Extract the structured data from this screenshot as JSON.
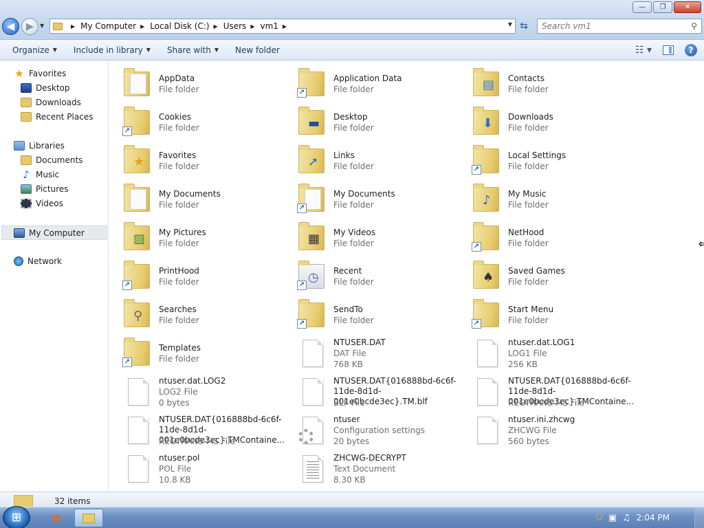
{
  "window": {
    "controls": {
      "minimize": "—",
      "maximize": "❐",
      "close": "✕"
    }
  },
  "nav": {
    "back": "◀",
    "forward": "▶"
  },
  "address": {
    "crumbs": [
      "My Computer",
      "Local Disk (C:)",
      "Users",
      "vm1"
    ]
  },
  "search": {
    "placeholder": "Search vm1"
  },
  "toolbar": {
    "organize": "Organize",
    "include": "Include in library",
    "share": "Share with",
    "new_folder": "New folder"
  },
  "sidebar": {
    "favorites": "Favorites",
    "desktop": "Desktop",
    "downloads": "Downloads",
    "recent": "Recent Places",
    "libraries": "Libraries",
    "documents": "Documents",
    "music": "Music",
    "pictures": "Pictures",
    "videos": "Videos",
    "computer": "My Computer",
    "network": "Network"
  },
  "items": [
    {
      "name": "AppData",
      "type": "File folder"
    },
    {
      "name": "Application Data",
      "type": "File folder"
    },
    {
      "name": "Contacts",
      "type": "File folder"
    },
    {
      "name": "Cookies",
      "type": "File folder"
    },
    {
      "name": "Desktop",
      "type": "File folder"
    },
    {
      "name": "Downloads",
      "type": "File folder"
    },
    {
      "name": "Favorites",
      "type": "File folder"
    },
    {
      "name": "Links",
      "type": "File folder"
    },
    {
      "name": "Local Settings",
      "type": "File folder"
    },
    {
      "name": "My Documents",
      "type": "File folder"
    },
    {
      "name": "My Documents",
      "type": "File folder"
    },
    {
      "name": "My Music",
      "type": "File folder"
    },
    {
      "name": "My Pictures",
      "type": "File folder"
    },
    {
      "name": "My Videos",
      "type": "File folder"
    },
    {
      "name": "NetHood",
      "type": "File folder"
    },
    {
      "name": "PrintHood",
      "type": "File folder"
    },
    {
      "name": "Recent",
      "type": "File folder"
    },
    {
      "name": "Saved Games",
      "type": "File folder"
    },
    {
      "name": "Searches",
      "type": "File folder"
    },
    {
      "name": "SendTo",
      "type": "File folder"
    },
    {
      "name": "Start Menu",
      "type": "File folder"
    },
    {
      "name": "Templates",
      "type": "File folder"
    },
    {
      "name": "NTUSER.DAT",
      "type": "DAT File",
      "size": "768 KB"
    },
    {
      "name": "ntuser.dat.LOG1",
      "type": "LOG1 File",
      "size": "256 KB"
    },
    {
      "name": "ntuser.dat.LOG2",
      "type": "LOG2 File",
      "size": "0 bytes"
    },
    {
      "name": "NTUSER.DAT{016888bd-6c6f-11de-8d1d-001e0bcde3ec}.TM.blf",
      "type": "BLF File"
    },
    {
      "name": "NTUSER.DAT{016888bd-6c6f-11de-8d1d-001e0bcde3ec}.TMContaine...",
      "type": "REGTRANS-MS File"
    },
    {
      "name": "NTUSER.DAT{016888bd-6c6f-11de-8d1d-001e0bcde3ec}.TMContaine...",
      "type": "REGTRANS-MS File"
    },
    {
      "name": "ntuser",
      "type": "Configuration settings",
      "size": "20 bytes"
    },
    {
      "name": "ntuser.ini.zhcwg",
      "type": "ZHCWG File",
      "size": "560 bytes"
    },
    {
      "name": "ntuser.pol",
      "type": "POL File",
      "size": "10.8 KB"
    },
    {
      "name": "ZHCWG-DECRYPT",
      "type": "Text Document",
      "size": "8.30 KB"
    }
  ],
  "status": {
    "count": "32 items"
  },
  "taskbar": {
    "time": "2:04 PM"
  },
  "colors": {
    "accent": "#2565c8",
    "folder": "#e7cc6e",
    "selection": "#e6eaef"
  }
}
